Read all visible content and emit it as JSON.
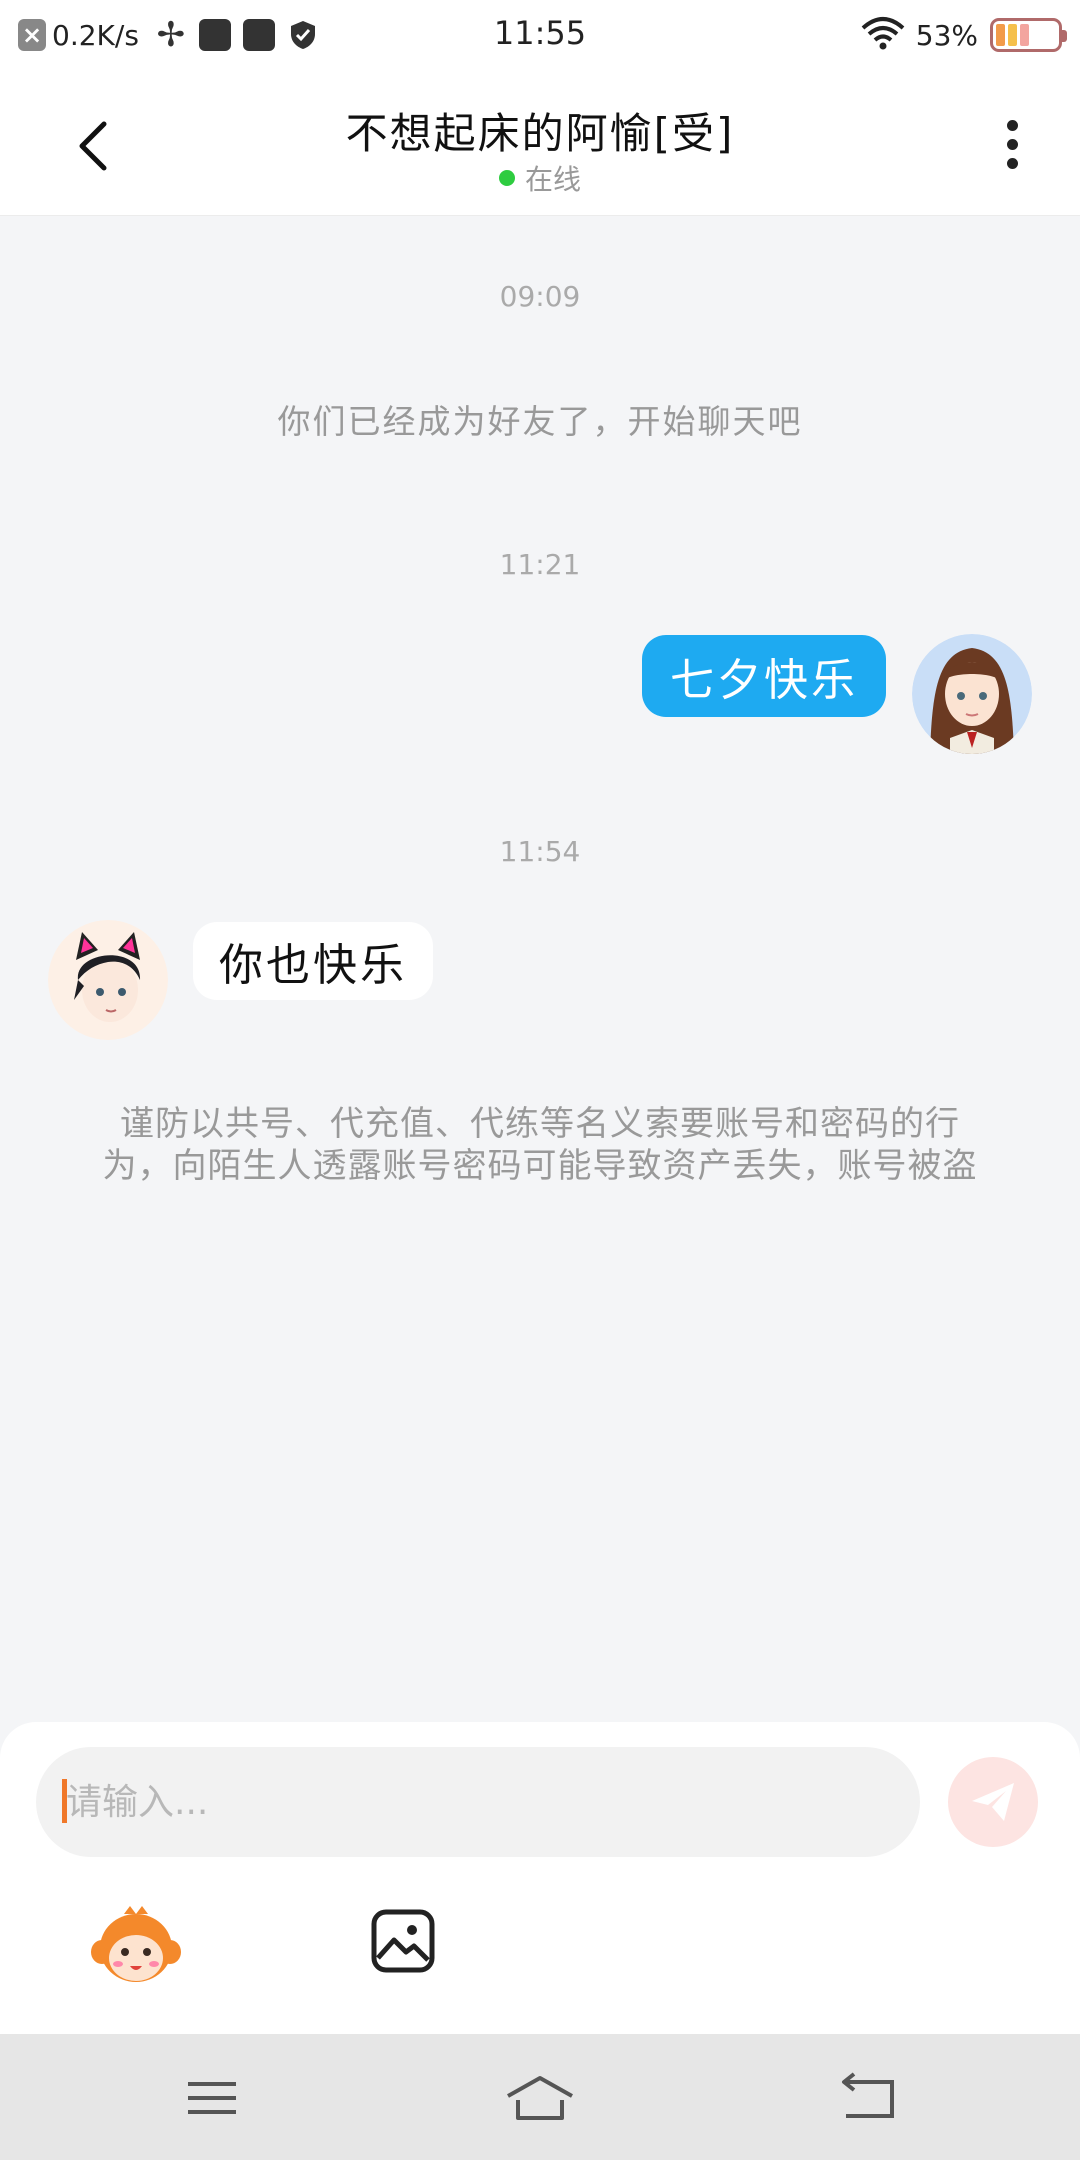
{
  "status_bar": {
    "speed": "0.2K/s",
    "time": "11:55",
    "battery_percent": "53%"
  },
  "header": {
    "title": "不想起床的阿愉[受]",
    "status": "在线",
    "status_color": "#2ecc40"
  },
  "chat": {
    "time1": "09:09",
    "system_message": "你们已经成为好友了，开始聊天吧",
    "time2": "11:21",
    "outgoing_message": "七夕快乐",
    "time3": "11:54",
    "incoming_message": "你也快乐",
    "notice": "谨防以共号、代充值、代练等名义索要账号和密码的行为，向陌生人透露账号密码可能导致资产丢失，账号被盗",
    "outgoing_bubble_color": "#1eaaf1"
  },
  "input": {
    "placeholder": "请输入..."
  },
  "icons": {
    "back": "back-arrow-icon",
    "more": "more-vertical-icon",
    "send": "send-icon",
    "emoji": "monkey-emoji-icon",
    "image": "image-icon",
    "nav_menu": "menu-icon",
    "nav_home": "home-icon",
    "nav_back": "return-icon"
  }
}
